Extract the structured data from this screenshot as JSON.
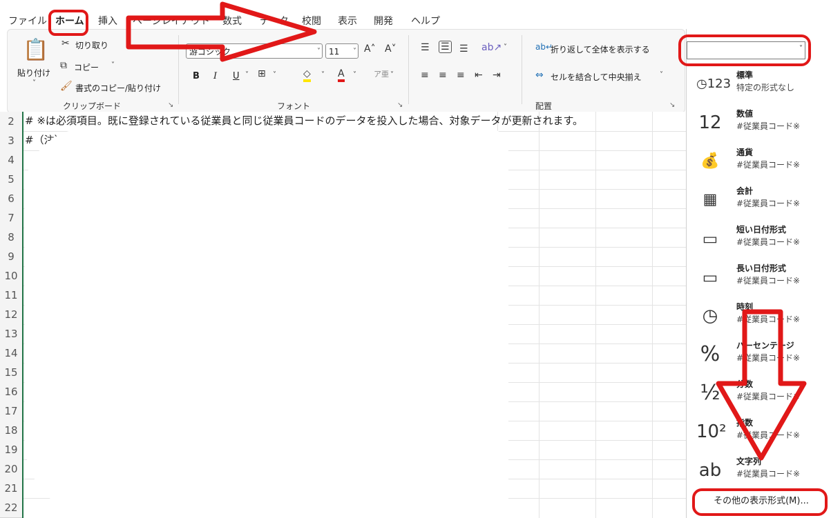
{
  "menu": {
    "tabs": [
      "ファイル",
      "ホーム",
      "挿入",
      "ページレイアウト",
      "数式",
      "データ",
      "校閲",
      "表示",
      "開発",
      "ヘルプ"
    ],
    "active": "ホーム"
  },
  "ribbon": {
    "clipboard": {
      "paste": "貼り付け",
      "cut": "切り取り",
      "copy": "コピー",
      "format_painter": "書式のコピー/貼り付け",
      "label": "クリップボード"
    },
    "font": {
      "name": "游ゴシック",
      "size": "11",
      "bold": "B",
      "italic": "I",
      "underline": "U",
      "label": "フォント"
    },
    "alignment": {
      "wrap": "折り返して全体を表示する",
      "merge": "セルを結合して中央揃え",
      "label": "配置"
    },
    "number_format_value": ""
  },
  "grid": {
    "rows": [
      "2",
      "3",
      "4",
      "5",
      "6",
      "7",
      "8",
      "9",
      "10",
      "11",
      "12",
      "13",
      "14",
      "15",
      "16",
      "17",
      "18",
      "19",
      "20",
      "21",
      "22"
    ],
    "row2_text": "# ※は必須項目。既に登録されている従業員と同じ従業員コードのデータを投入した場合、対象データが更新されます。",
    "row3_text": "#（注）"
  },
  "number_formats": [
    {
      "name": "標準",
      "sample": "特定の形式なし",
      "icon": "clock-123-icon"
    },
    {
      "name": "数値",
      "sample": "#従業員コード※",
      "icon": "number-12-icon"
    },
    {
      "name": "通貨",
      "sample": "#従業員コード※",
      "icon": "currency-icon"
    },
    {
      "name": "会計",
      "sample": "#従業員コード※",
      "icon": "accounting-icon"
    },
    {
      "name": "短い日付形式",
      "sample": "#従業員コード※",
      "icon": "calendar-icon"
    },
    {
      "name": "長い日付形式",
      "sample": "#従業員コード※",
      "icon": "calendar-icon"
    },
    {
      "name": "時刻",
      "sample": "#従業員コード※",
      "icon": "clock-icon"
    },
    {
      "name": "パーセンテージ",
      "sample": "#従業員コード※",
      "icon": "percent-icon"
    },
    {
      "name": "分数",
      "sample": "#従業員コード※",
      "icon": "fraction-icon"
    },
    {
      "name": "指数",
      "sample": "#従業員コード※",
      "icon": "exponent-icon"
    },
    {
      "name": "文字列",
      "sample": "#従業員コード※",
      "icon": "text-ab-icon"
    }
  ],
  "more_formats": "その他の表示形式(M)...",
  "colors": {
    "highlight": "#e11818",
    "excel_green": "#217346"
  }
}
